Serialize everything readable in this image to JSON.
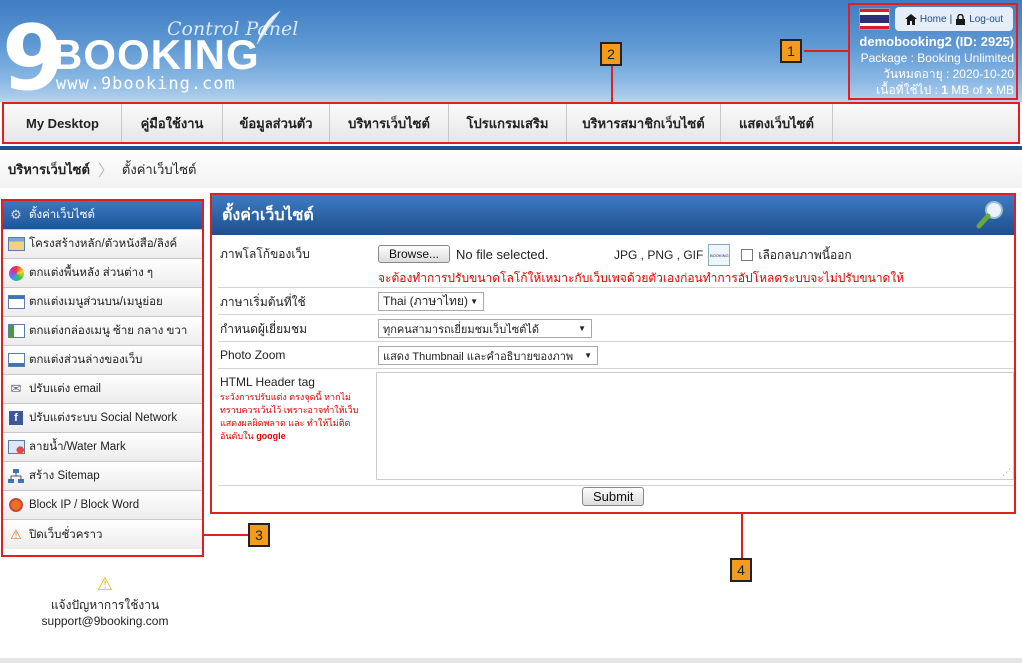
{
  "header": {
    "logo_digit": "9",
    "logo_word": "BOOKING",
    "logo_url": "www.9booking.com",
    "logo_subtitle": "Control Panel",
    "home_link": "Home",
    "logout_link": "Log-out",
    "link_separator": "|",
    "account": "demobooking2 (ID: 2925)",
    "package": "Package : Booking Unlimited",
    "expiry": "วันหมดอายุ : 2020-10-20",
    "space_prefix": "เนื้อที่ใช้ไป : ",
    "space_used": "1",
    "space_middle": " MB of ",
    "space_total": "x",
    "space_suffix": " MB"
  },
  "nav": {
    "items": [
      "My Desktop",
      "คู่มือใช้งาน",
      "ข้อมูลส่วนตัว",
      "บริหารเว็บไซต์",
      "โปรแกรมเสริม",
      "บริหารสมาชิกเว็บไซต์",
      "แสดงเว็บไซต์"
    ]
  },
  "breadcrumb": {
    "parent": "บริหารเว็บไซต์",
    "current": "ตั้งค่าเว็บไซต์"
  },
  "sidebar": {
    "items": [
      {
        "label": "ตั้งค่าเว็บไซต์",
        "icon": "gear-icon"
      },
      {
        "label": "โครงสร้างหลัก/ตัวหนังสือ/ลิงค์",
        "icon": "layout-icon"
      },
      {
        "label": "ตกแต่งพื้นหลัง ส่วนต่าง ๆ",
        "icon": "palette-icon"
      },
      {
        "label": "ตกแต่งเมนูส่วนบน/เมนูย่อย",
        "icon": "top-menu-icon"
      },
      {
        "label": "ตกแต่งกล่องเมนู ซ้าย กลาง ขวา",
        "icon": "menu-box-icon"
      },
      {
        "label": "ตกแต่งส่วนล่างของเว็บ",
        "icon": "footer-icon"
      },
      {
        "label": "ปรับแต่ง email",
        "icon": "email-icon"
      },
      {
        "label": "ปรับแต่งระบบ Social Network",
        "icon": "social-icon"
      },
      {
        "label": "ลายน้ำ/Water Mark",
        "icon": "watermark-icon"
      },
      {
        "label": "สร้าง Sitemap",
        "icon": "sitemap-icon"
      },
      {
        "label": "Block IP / Block Word",
        "icon": "block-icon"
      },
      {
        "label": "ปิดเว็บชั่วคราว",
        "icon": "warning-sign-icon"
      }
    ]
  },
  "support": {
    "line1": "แจ้งปัญหาการใช้งาน",
    "email": "support@9booking.com"
  },
  "main": {
    "title": "ตั้งค่าเว็บไซต์",
    "logo": {
      "label": "ภาพโลโก้ของเว็บ",
      "browse_button": "Browse...",
      "file_status": "No file selected.",
      "formats": "JPG , PNG , GIF",
      "thumb_text": "BOOKING",
      "remove_label": "เลือกลบภาพนี้ออก",
      "remove_checked": false,
      "note": "จะต้องทำการปรับขนาดโลโก้ให้เหมาะกับเว็บเพจด้วยตัวเองก่อนทำการอัปโหลดระบบจะไม่ปรับขนาดให้"
    },
    "language": {
      "label": "ภาษาเริ่มต้นที่ใช้",
      "value": "Thai (ภาษาไทย)"
    },
    "visitors": {
      "label": "กำหนดผู้เยี่ยมชม",
      "value": "ทุกคนสามารถเยี่ยมชมเว็บไซต์ได้"
    },
    "photo_zoom": {
      "label": "Photo Zoom",
      "value": "แสดง Thumbnail และคำอธิบายของภาพ"
    },
    "html_header": {
      "label": "HTML Header tag",
      "warning": "ระวังการปรับแต่ง ตรงจุดนี้ หากไม่ทราบควรเว้นไว้ เพราะอาจทำให้เว็บแสดงผลผิดพลาด และ ทำให้ไม่ติดอันดับใน",
      "warning_bold": "google",
      "value": ""
    },
    "submit_button": "Submit"
  },
  "callouts": [
    "1",
    "2",
    "3",
    "4"
  ],
  "colors": {
    "annotation_red": "#e02020",
    "callout_orange": "#f29b1d",
    "brand_blue": "#1d4f8e"
  }
}
